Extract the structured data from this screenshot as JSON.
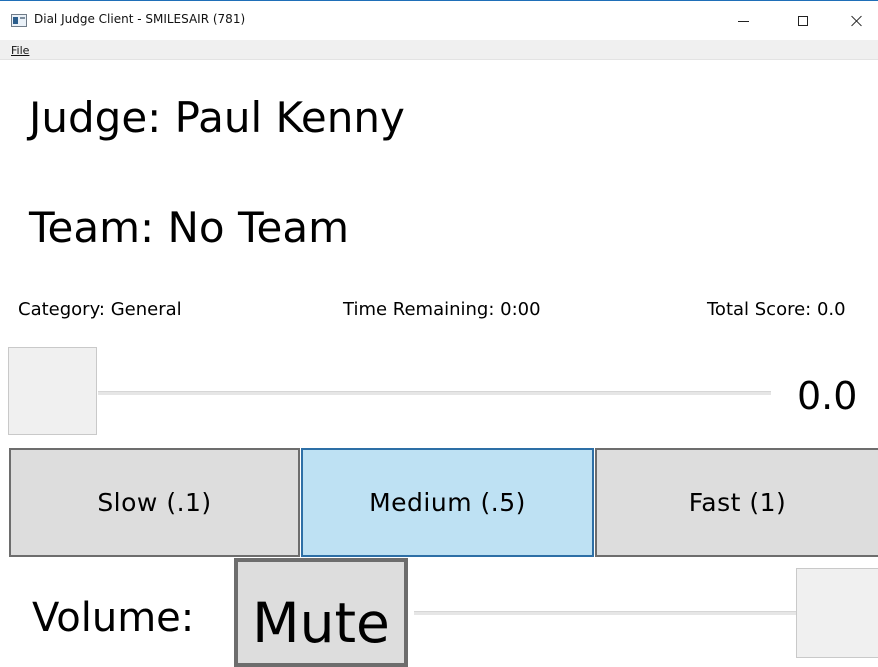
{
  "window": {
    "title": "Dial Judge Client - SMILESAIR (781)",
    "app_icon": "app-window-icon",
    "controls": {
      "minimize_icon": "minimize-icon",
      "maximize_icon": "maximize-icon",
      "close_icon": "close-icon"
    }
  },
  "menu": {
    "file": "File"
  },
  "header": {
    "judge": "Judge: Paul Kenny",
    "team": "Team: No Team"
  },
  "info": {
    "category": "Category: General",
    "time_remaining": "Time Remaining: 0:00",
    "total_score": "Total Score: 0.0"
  },
  "score": {
    "value": "0.0",
    "slider_fraction": 0
  },
  "speed": {
    "slow": "Slow (.1)",
    "medium": "Medium (.5)",
    "fast": "Fast (1)",
    "selected": "medium",
    "selected_color": "#bee1f3"
  },
  "volume": {
    "label": "Volume:",
    "mute": "Mute",
    "slider_fraction": 1
  }
}
